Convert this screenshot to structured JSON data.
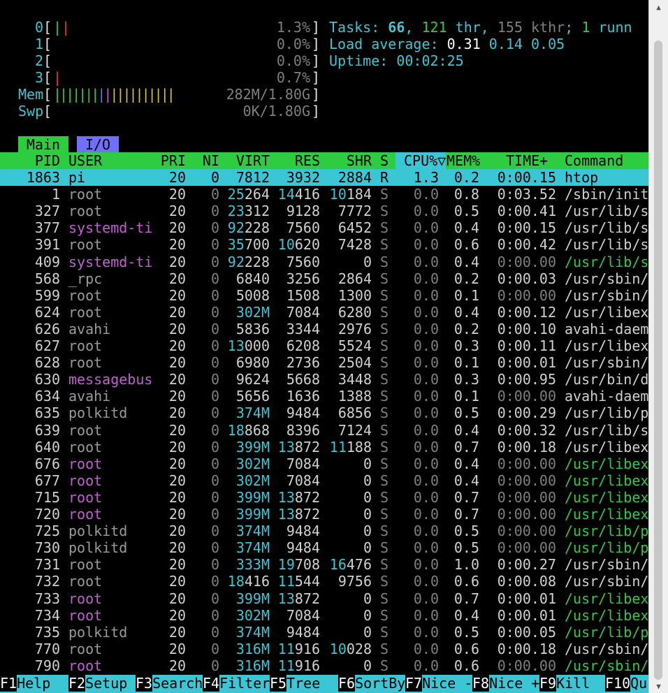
{
  "meters": {
    "cpus": [
      {
        "label": "0",
        "open": "[",
        "bar": [
          {
            "t": "|",
            "c": "g"
          },
          {
            "t": "|",
            "c": "r"
          }
        ],
        "value": "1.3%",
        "close": "]"
      },
      {
        "label": "1",
        "open": "[",
        "bar": [],
        "value": "0.0%",
        "close": "]"
      },
      {
        "label": "2",
        "open": "[",
        "bar": [],
        "value": "0.0%",
        "close": "]"
      },
      {
        "label": "3",
        "open": "[",
        "bar": [
          {
            "t": "|",
            "c": "r"
          }
        ],
        "value": "0.7%",
        "close": "]"
      }
    ],
    "mem": {
      "label": "Mem",
      "open": "[",
      "bar": "|||||||",
      "bar_b": "|",
      "bar_m": "|",
      "bar_y": "||||||||||",
      "value": "282M/1.80G",
      "close": "]"
    },
    "swp": {
      "label": "Swp",
      "open": "[",
      "value": "0K/1.80G",
      "close": "]"
    }
  },
  "summary": {
    "tasks_label": "Tasks: ",
    "tasks": "66",
    "sep1": ", ",
    "threads": "121",
    "thr": " thr",
    "sep2": ", ",
    "kthreads": "155",
    "kthr": " kthr",
    "sep3": "; ",
    "running": "1",
    "runn": " runn",
    "load_label": "Load average: ",
    "load1": "0.31",
    "load5": "0.14",
    "load15": "0.05",
    "uptime_label": "Uptime: ",
    "uptime": "00:02:25"
  },
  "tabs": {
    "main": "Main",
    "io": "I/O"
  },
  "columns": {
    "pid": "PID",
    "user": "USER",
    "pri": "PRI",
    "ni": "NI",
    "virt": "VIRT",
    "res": "RES",
    "shr": "SHR",
    "s": "S",
    "cpu": "CPU%",
    "sort_indicator": "▽",
    "mem": "MEM%",
    "time": "TIME+",
    "command": "Command"
  },
  "processes": [
    {
      "pid": "1863",
      "user": "pi",
      "pri": "20",
      "ni": "0",
      "virt": "7812",
      "res": "3932",
      "shr": "2884",
      "s": "R",
      "cpu": "1.3",
      "mem": "0.2",
      "time": "0:00.15",
      "command": "htop",
      "selected": true
    },
    {
      "pid": "1",
      "user": "root",
      "pri": "20",
      "ni": "0",
      "virt": "25264",
      "res": "14416",
      "shr": "10184",
      "s": "S",
      "cpu": "0.0",
      "mem": "0.8",
      "time": "0:03.52",
      "command": "/sbin/init"
    },
    {
      "pid": "327",
      "user": "root",
      "pri": "20",
      "ni": "0",
      "virt": "23312",
      "res": "9128",
      "shr": "7772",
      "s": "S",
      "cpu": "0.0",
      "mem": "0.5",
      "time": "0:00.41",
      "command": "/usr/lib/s"
    },
    {
      "pid": "377",
      "user": "systemd-ti",
      "user_color": "m",
      "pri": "20",
      "ni": "0",
      "virt": "92228",
      "res": "7560",
      "shr": "6452",
      "s": "S",
      "cpu": "0.0",
      "mem": "0.4",
      "time": "0:00.15",
      "command": "/usr/lib/s"
    },
    {
      "pid": "391",
      "user": "root",
      "pri": "20",
      "ni": "0",
      "virt": "35700",
      "res": "10620",
      "shr": "7428",
      "s": "S",
      "cpu": "0.0",
      "mem": "0.6",
      "time": "0:00.42",
      "command": "/usr/lib/s"
    },
    {
      "pid": "409",
      "user": "systemd-ti",
      "user_color": "m",
      "pri": "20",
      "ni": "0",
      "virt": "92228",
      "res": "7560",
      "shr": "0",
      "s": "S",
      "cpu": "0.0",
      "mem": "0.4",
      "time": "0:00.00",
      "command": "/usr/lib/s",
      "thread": true
    },
    {
      "pid": "568",
      "user": "_rpc",
      "pri": "20",
      "ni": "0",
      "virt": "6840",
      "res": "3256",
      "shr": "2864",
      "s": "S",
      "cpu": "0.0",
      "mem": "0.2",
      "time": "0:00.03",
      "command": "/usr/sbin/"
    },
    {
      "pid": "599",
      "user": "root",
      "pri": "20",
      "ni": "0",
      "virt": "5008",
      "res": "1508",
      "shr": "1300",
      "s": "S",
      "cpu": "0.0",
      "mem": "0.1",
      "time": "0:00.00",
      "command": "/usr/sbin/"
    },
    {
      "pid": "624",
      "user": "root",
      "pri": "20",
      "ni": "0",
      "virt": "302M",
      "res": "7084",
      "shr": "6280",
      "s": "S",
      "cpu": "0.0",
      "mem": "0.4",
      "time": "0:00.12",
      "command": "/usr/libex"
    },
    {
      "pid": "626",
      "user": "avahi",
      "pri": "20",
      "ni": "0",
      "virt": "5836",
      "res": "3344",
      "shr": "2976",
      "s": "S",
      "cpu": "0.0",
      "mem": "0.2",
      "time": "0:00.10",
      "command": "avahi-daem"
    },
    {
      "pid": "627",
      "user": "root",
      "pri": "20",
      "ni": "0",
      "virt": "13000",
      "res": "6208",
      "shr": "5524",
      "s": "S",
      "cpu": "0.0",
      "mem": "0.3",
      "time": "0:00.11",
      "command": "/usr/libex"
    },
    {
      "pid": "628",
      "user": "root",
      "pri": "20",
      "ni": "0",
      "virt": "6980",
      "res": "2736",
      "shr": "2504",
      "s": "S",
      "cpu": "0.0",
      "mem": "0.1",
      "time": "0:00.01",
      "command": "/usr/sbin/"
    },
    {
      "pid": "630",
      "user": "messagebus",
      "user_color": "m",
      "pri": "20",
      "ni": "0",
      "virt": "9624",
      "res": "5668",
      "shr": "3448",
      "s": "S",
      "cpu": "0.0",
      "mem": "0.3",
      "time": "0:00.95",
      "command": "/usr/bin/d"
    },
    {
      "pid": "634",
      "user": "avahi",
      "pri": "20",
      "ni": "0",
      "virt": "5656",
      "res": "1636",
      "shr": "1388",
      "s": "S",
      "cpu": "0.0",
      "mem": "0.1",
      "time": "0:00.00",
      "command": "avahi-daem"
    },
    {
      "pid": "635",
      "user": "polkitd",
      "pri": "20",
      "ni": "0",
      "virt": "374M",
      "res": "9484",
      "shr": "6856",
      "s": "S",
      "cpu": "0.0",
      "mem": "0.5",
      "time": "0:00.29",
      "command": "/usr/lib/p"
    },
    {
      "pid": "639",
      "user": "root",
      "pri": "20",
      "ni": "0",
      "virt": "18868",
      "res": "8396",
      "shr": "7124",
      "s": "S",
      "cpu": "0.0",
      "mem": "0.4",
      "time": "0:00.32",
      "command": "/usr/lib/s"
    },
    {
      "pid": "640",
      "user": "root",
      "pri": "20",
      "ni": "0",
      "virt": "399M",
      "res": "13872",
      "shr": "11188",
      "s": "S",
      "cpu": "0.0",
      "mem": "0.7",
      "time": "0:00.18",
      "command": "/usr/libex"
    },
    {
      "pid": "676",
      "user": "root",
      "user_color": "m",
      "pri": "20",
      "ni": "0",
      "virt": "302M",
      "res": "7084",
      "shr": "0",
      "s": "S",
      "cpu": "0.0",
      "mem": "0.4",
      "time": "0:00.00",
      "command": "/usr/libex",
      "thread": true
    },
    {
      "pid": "677",
      "user": "root",
      "user_color": "m",
      "pri": "20",
      "ni": "0",
      "virt": "302M",
      "res": "7084",
      "shr": "0",
      "s": "S",
      "cpu": "0.0",
      "mem": "0.4",
      "time": "0:00.00",
      "command": "/usr/libex",
      "thread": true
    },
    {
      "pid": "715",
      "user": "root",
      "user_color": "m",
      "pri": "20",
      "ni": "0",
      "virt": "399M",
      "res": "13872",
      "shr": "0",
      "s": "S",
      "cpu": "0.0",
      "mem": "0.7",
      "time": "0:00.00",
      "command": "/usr/libex",
      "thread": true
    },
    {
      "pid": "720",
      "user": "root",
      "user_color": "m",
      "pri": "20",
      "ni": "0",
      "virt": "399M",
      "res": "13872",
      "shr": "0",
      "s": "S",
      "cpu": "0.0",
      "mem": "0.7",
      "time": "0:00.00",
      "command": "/usr/libex",
      "thread": true
    },
    {
      "pid": "725",
      "user": "polkitd",
      "pri": "20",
      "ni": "0",
      "virt": "374M",
      "res": "9484",
      "shr": "0",
      "s": "S",
      "cpu": "0.0",
      "mem": "0.5",
      "time": "0:00.00",
      "command": "/usr/lib/p",
      "thread": true
    },
    {
      "pid": "730",
      "user": "polkitd",
      "pri": "20",
      "ni": "0",
      "virt": "374M",
      "res": "9484",
      "shr": "0",
      "s": "S",
      "cpu": "0.0",
      "mem": "0.5",
      "time": "0:00.00",
      "command": "/usr/lib/p",
      "thread": true
    },
    {
      "pid": "731",
      "user": "root",
      "pri": "20",
      "ni": "0",
      "virt": "333M",
      "res": "19708",
      "shr": "16476",
      "s": "S",
      "cpu": "0.0",
      "mem": "1.0",
      "time": "0:00.27",
      "command": "/usr/sbin/"
    },
    {
      "pid": "732",
      "user": "root",
      "pri": "20",
      "ni": "0",
      "virt": "18416",
      "res": "11544",
      "shr": "9756",
      "s": "S",
      "cpu": "0.0",
      "mem": "0.6",
      "time": "0:00.08",
      "command": "/usr/sbin/"
    },
    {
      "pid": "733",
      "user": "root",
      "user_color": "m",
      "pri": "20",
      "ni": "0",
      "virt": "399M",
      "res": "13872",
      "shr": "0",
      "s": "S",
      "cpu": "0.0",
      "mem": "0.7",
      "time": "0:00.01",
      "command": "/usr/libex",
      "thread": true
    },
    {
      "pid": "734",
      "user": "root",
      "user_color": "m",
      "pri": "20",
      "ni": "0",
      "virt": "302M",
      "res": "7084",
      "shr": "0",
      "s": "S",
      "cpu": "0.0",
      "mem": "0.4",
      "time": "0:00.01",
      "command": "/usr/libex",
      "thread": true
    },
    {
      "pid": "735",
      "user": "polkitd",
      "pri": "20",
      "ni": "0",
      "virt": "374M",
      "res": "9484",
      "shr": "0",
      "s": "S",
      "cpu": "0.0",
      "mem": "0.5",
      "time": "0:00.05",
      "command": "/usr/lib/p",
      "thread": true
    },
    {
      "pid": "770",
      "user": "root",
      "pri": "20",
      "ni": "0",
      "virt": "316M",
      "res": "11916",
      "shr": "10028",
      "s": "S",
      "cpu": "0.0",
      "mem": "0.6",
      "time": "0:00.18",
      "command": "/usr/sbin/"
    },
    {
      "pid": "790",
      "user": "root",
      "user_color": "m",
      "pri": "20",
      "ni": "0",
      "virt": "316M",
      "res": "11916",
      "shr": "0",
      "s": "S",
      "cpu": "0.0",
      "mem": "0.6",
      "time": "0:00.00",
      "command": "/usr/sbin/",
      "thread": true
    }
  ],
  "function_keys": [
    {
      "key": "F1",
      "label": "Help"
    },
    {
      "key": "F2",
      "label": "Setup"
    },
    {
      "key": "F3",
      "label": "Search"
    },
    {
      "key": "F4",
      "label": "Filter"
    },
    {
      "key": "F5",
      "label": "Tree"
    },
    {
      "key": "F6",
      "label": "SortBy"
    },
    {
      "key": "F7",
      "label": "Nice -"
    },
    {
      "key": "F8",
      "label": "Nice +"
    },
    {
      "key": "F9",
      "label": "Kill"
    },
    {
      "key": "F10",
      "label": "Qu"
    }
  ],
  "colors": {
    "green": "#2ecc40",
    "cyan": "#3bc6d6",
    "magenta": "#c060d0",
    "blue": "#7070ff",
    "red": "#e23b3b",
    "yellow": "#d9c23a",
    "gray": "#7f7f7f"
  },
  "scrollbar": {
    "up_icon": "triangle-up",
    "down_icon": "triangle-down"
  }
}
